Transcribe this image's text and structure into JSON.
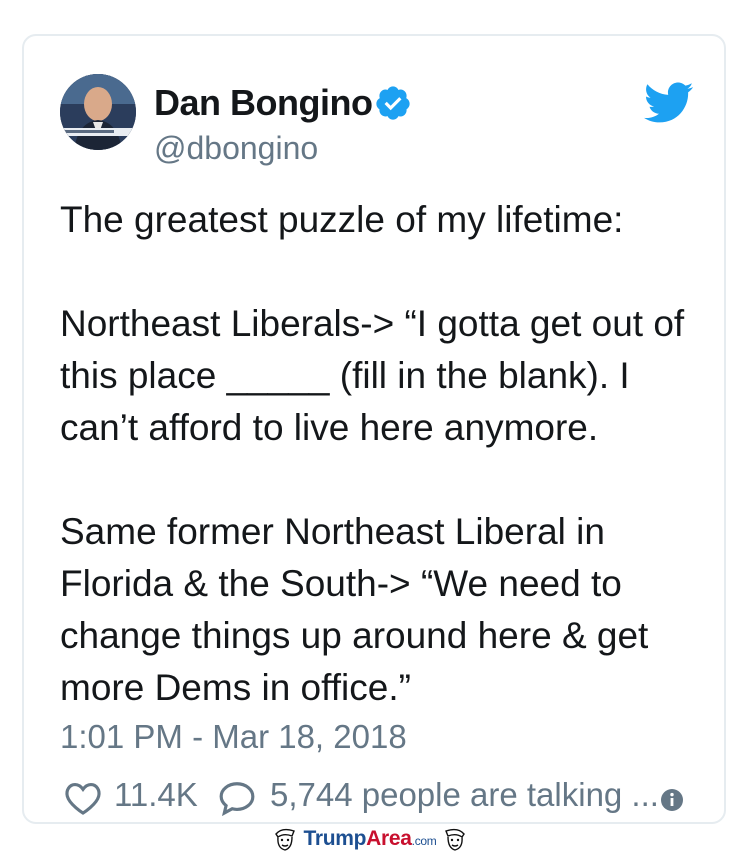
{
  "tweet": {
    "author_name": "Dan Bongino",
    "handle": "@dbongino",
    "paragraphs": [
      "The greatest puzzle of my lifetime:",
      "Northeast Liberals-> “I gotta get out of this place _____ (fill in the blank). I can’t afford to live here anymore.",
      "Same former Northeast Liberal in Florida & the South-> “We need to change things up around here & get more Dems in office.”"
    ],
    "timestamp": "1:01 PM - Mar 18, 2018",
    "likes": "11.4K",
    "talking": "5,744 people are talking ..."
  },
  "watermark": {
    "brand_a": "Trump",
    "brand_b": "Area",
    "suffix": ".com"
  },
  "icons": {
    "verified": "verified-badge-icon",
    "bird": "twitter-bird-icon",
    "heart": "heart-icon",
    "comment": "comment-bubble-icon",
    "info": "info-icon"
  },
  "colors": {
    "twitter_blue": "#1da1f2",
    "text": "#14171a",
    "muted": "#657786"
  }
}
